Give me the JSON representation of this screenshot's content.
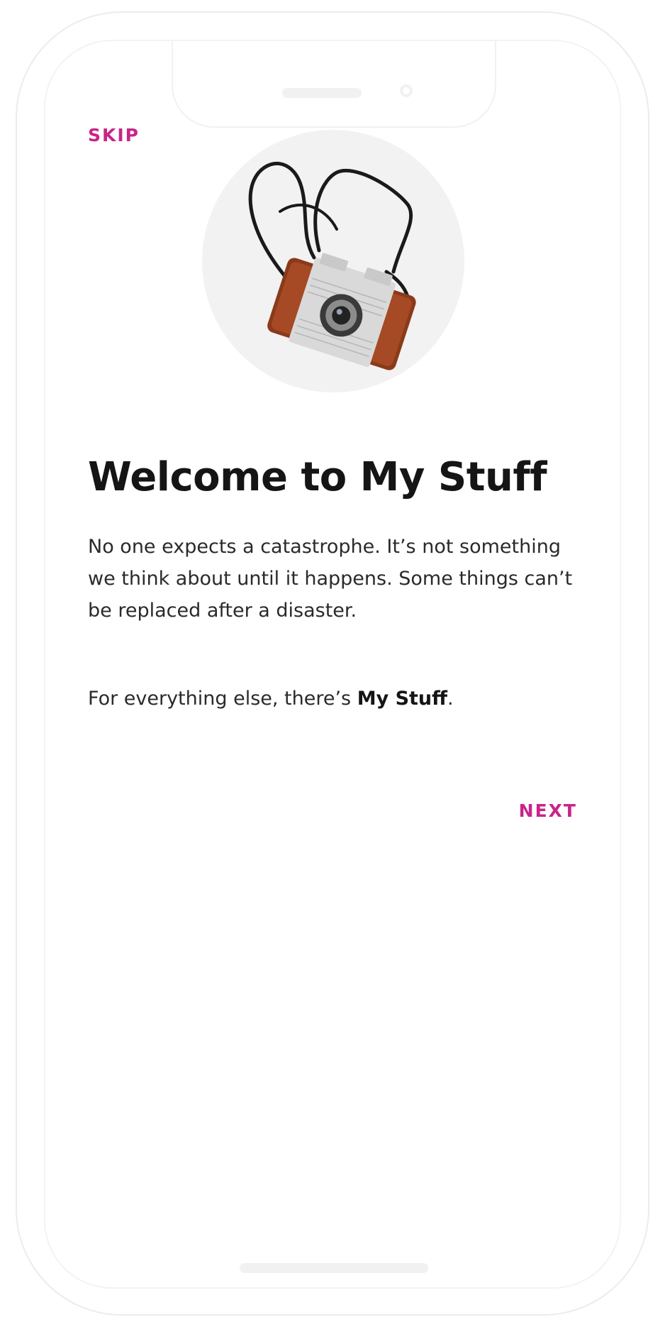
{
  "onboarding": {
    "skip_label": "SKIP",
    "next_label": "NEXT",
    "title": "Welcome to My Stuff",
    "paragraph_1": "No one expects a catastrophe. It’s not something we think about until it happens. Some things can’t be replaced after a disaster.",
    "paragraph_2_prefix": "For everything else, there’s ",
    "paragraph_2_brand": "My Stuff",
    "paragraph_2_suffix": ".",
    "hero_image": "vintage-camera-photo"
  },
  "colors": {
    "accent": "#c9248a",
    "text_primary": "#151515",
    "text_body": "#2a2a2a",
    "background": "#ffffff"
  }
}
